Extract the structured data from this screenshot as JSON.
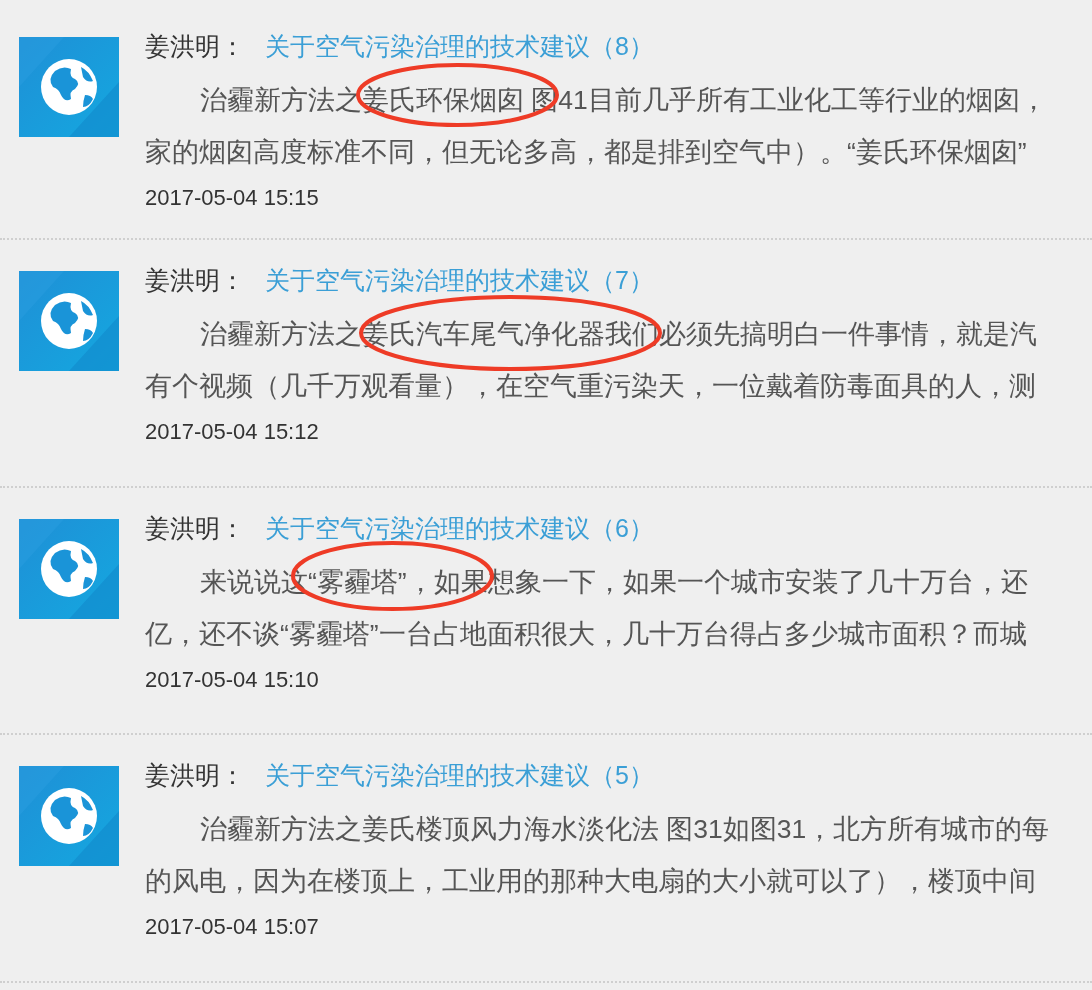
{
  "posts": [
    {
      "author": "姜洪明：",
      "title": "关于空气污染治理的技术建议（8）",
      "lines": [
        "治霾新方法之姜氏环保烟囱 图41目前几乎所有工业化工等行业的烟囱，",
        "家的烟囱高度标准不同，但无论多高，都是排到空气中）。“姜氏环保烟囱”"
      ],
      "time": "2017-05-04 15:15",
      "circled": true
    },
    {
      "author": "姜洪明：",
      "title": "关于空气污染治理的技术建议（7）",
      "lines": [
        "治霾新方法之姜氏汽车尾气净化器我们必须先搞明白一件事情，就是汽",
        "有个视频（几千万观看量），在空气重污染天，一位戴着防毒面具的人，测"
      ],
      "time": "2017-05-04 15:12",
      "circled": true
    },
    {
      "author": "姜洪明：",
      "title": "关于空气污染治理的技术建议（6）",
      "lines": [
        "来说说这“雾霾塔”，如果想象一下，如果一个城市安装了几十万台，还",
        "亿，还不谈“雾霾塔”一台占地面积很大，几十万台得占多少城市面积？而城"
      ],
      "time": "2017-05-04 15:10",
      "circled": true
    },
    {
      "author": "姜洪明：",
      "title": "关于空气污染治理的技术建议（5）",
      "lines": [
        "治霾新方法之姜氏楼顶风力海水淡化法 图31如图31，北方所有城市的每",
        "的风电，因为在楼顶上，工业用的那种大电扇的大小就可以了），楼顶中间"
      ],
      "time": "2017-05-04 15:07",
      "circled": false
    }
  ]
}
